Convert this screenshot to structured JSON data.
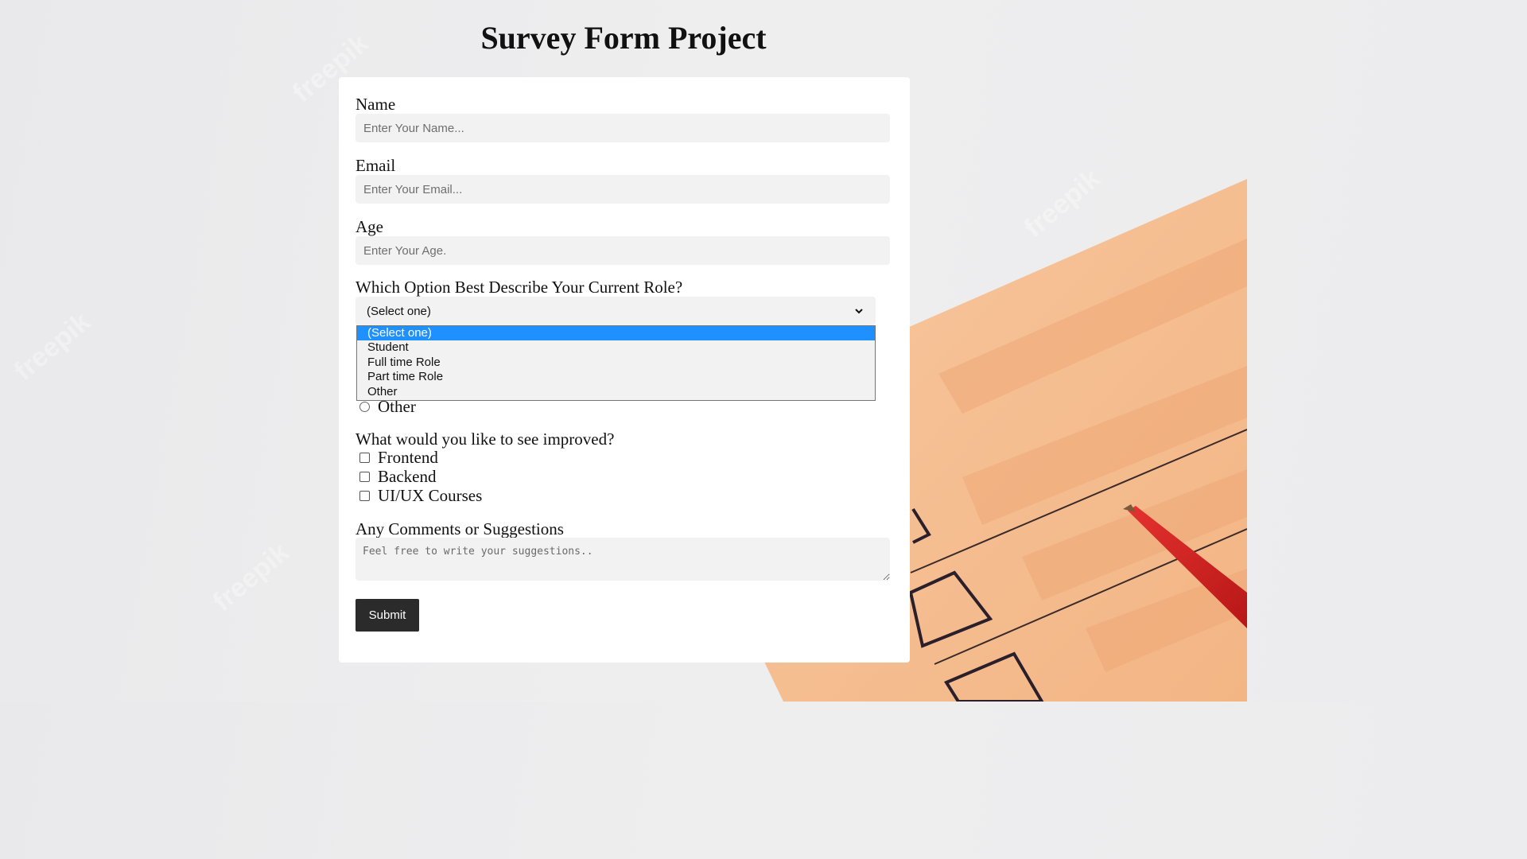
{
  "page": {
    "title": "Survey Form Project"
  },
  "form": {
    "name": {
      "label": "Name",
      "placeholder": "Enter Your Name..."
    },
    "email": {
      "label": "Email",
      "placeholder": "Enter Your Email..."
    },
    "age": {
      "label": "Age",
      "placeholder": "Enter Your Age."
    },
    "role": {
      "label": "Which Option Best Describe Your Current Role?",
      "selected": "(Select one)",
      "options": [
        "(Select one)",
        "Student",
        "Full time Role",
        "Part time Role",
        "Other"
      ]
    },
    "recommend": {
      "visible_option": "Other"
    },
    "improve": {
      "label": "What would you like to see improved?",
      "options": [
        "Frontend",
        "Backend",
        "UI/UX Courses"
      ]
    },
    "comments": {
      "label": "Any Comments or Suggestions",
      "placeholder": "Feel free to write your suggestions.."
    },
    "submit_label": "Submit"
  },
  "colors": {
    "accent_selected": "#1e90ff",
    "submit_bg": "#2b2b2b",
    "input_bg": "#f2f2f2"
  },
  "icons": {
    "select_arrow": "chevron-down-icon"
  }
}
